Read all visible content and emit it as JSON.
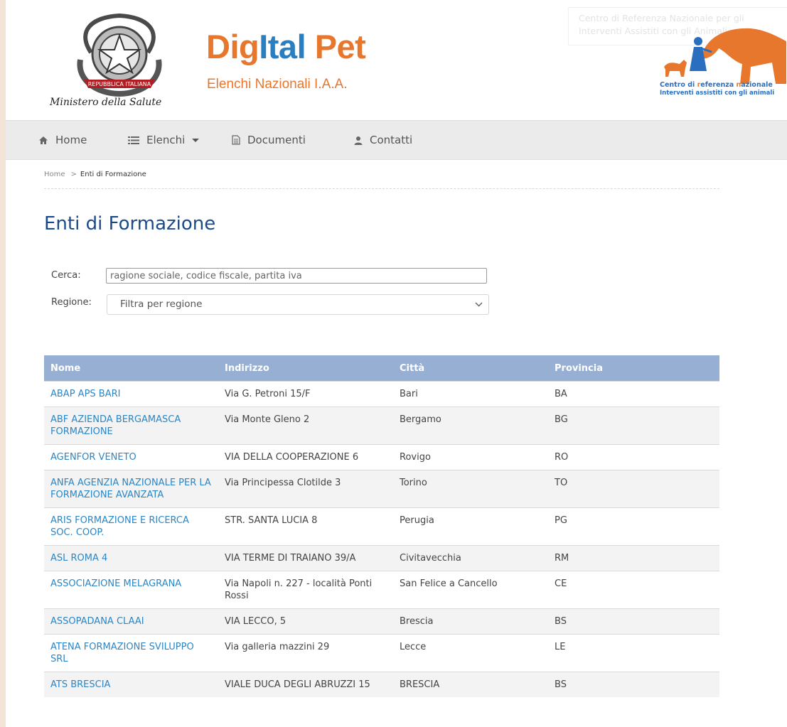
{
  "header": {
    "ministry_name": "Ministero della Salute",
    "emblem_ribbon": "REPUBBLICA ITALIANA",
    "brand_part1": "Dig",
    "brand_part2": "Ital",
    "brand_part3": " Pet",
    "subtitle": "Elenchi Nazionali I.A.A.",
    "tooltip": "Centro di Referenza Nazionale per gli Interventi Assistiti con gli Animali",
    "crn_line1_prefix": "Centro di ",
    "crn_line1_r": "r",
    "crn_line1_mid": "eferenza ",
    "crn_line1_n": "n",
    "crn_line1_end": "azionale",
    "crn_line2": "Interventi assistiti con gli animali",
    "colors": {
      "orange": "#e8772e",
      "blue": "#2a7fc0"
    }
  },
  "nav": {
    "home": "Home",
    "elenchi": "Elenchi",
    "documenti": "Documenti",
    "contatti": "Contatti"
  },
  "breadcrumb": {
    "home": "Home",
    "separator": ">",
    "current": "Enti di Formazione"
  },
  "page": {
    "title": "Enti di Formazione"
  },
  "filters": {
    "search_label": "Cerca:",
    "search_placeholder": "ragione sociale, codice fiscale, partita iva",
    "region_label": "Regione:",
    "region_value": "Filtra per regione"
  },
  "table": {
    "headers": [
      "Nome",
      "Indirizzo",
      "Città",
      "Provincia"
    ],
    "rows": [
      [
        "ABAP APS BARI",
        "Via G. Petroni 15/F",
        "Bari",
        "BA"
      ],
      [
        "ABF AZIENDA BERGAMASCA FORMAZIONE",
        "Via Monte Gleno 2",
        "Bergamo",
        "BG"
      ],
      [
        "AGENFOR VENETO",
        "VIA DELLA COOPERAZIONE 6",
        "Rovigo",
        "RO"
      ],
      [
        "ANFA AGENZIA NAZIONALE PER LA FORMAZIONE AVANZATA",
        "Via Principessa Clotilde 3",
        "Torino",
        "TO"
      ],
      [
        "ARIS FORMAZIONE E RICERCA SOC. COOP.",
        "STR. SANTA LUCIA 8",
        "Perugia",
        "PG"
      ],
      [
        "ASL ROMA 4",
        "VIA TERME DI TRAIANO 39/A",
        "Civitavecchia",
        "RM"
      ],
      [
        "ASSOCIAZIONE MELAGRANA",
        "Via Napoli n. 227 - località Ponti Rossi",
        "San Felice a Cancello",
        "CE"
      ],
      [
        "ASSOPADANA CLAAI",
        "VIA LECCO, 5",
        "Brescia",
        "BS"
      ],
      [
        "ATENA FORMAZIONE SVILUPPO SRL",
        "Via galleria mazzini 29",
        "Lecce",
        "LE"
      ],
      [
        "ATS BRESCIA",
        "VIALE DUCA DEGLI ABRUZZI 15",
        "BRESCIA",
        "BS"
      ]
    ]
  }
}
